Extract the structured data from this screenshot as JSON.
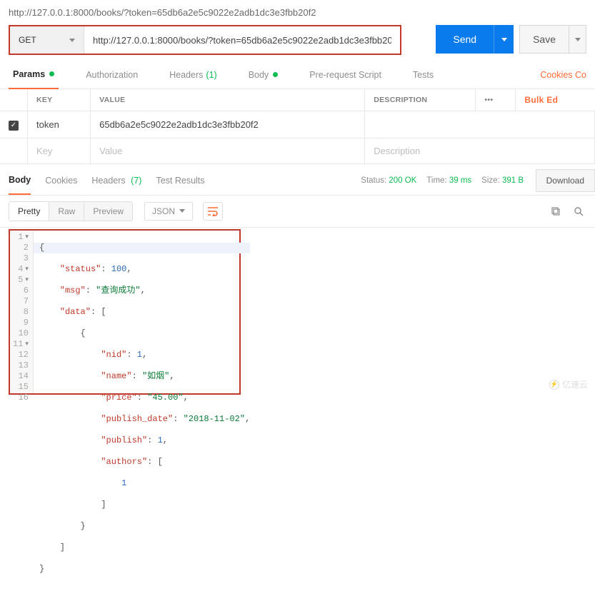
{
  "url_display": "http://127.0.0.1:8000/books/?token=65db6a2e5c9022e2adb1dc3e3fbb20f2",
  "request": {
    "method": "GET",
    "url": "http://127.0.0.1:8000/books/?token=65db6a2e5c9022e2adb1dc3e3fbb20f2"
  },
  "buttons": {
    "send": "Send",
    "save": "Save",
    "download": "Download"
  },
  "tabs": {
    "params": "Params",
    "authorization": "Authorization",
    "headers": "Headers",
    "headers_count": "(1)",
    "body": "Body",
    "prerequest": "Pre-request Script",
    "tests": "Tests",
    "cookies_link": "Cookies  Co"
  },
  "params_table": {
    "head": {
      "key": "KEY",
      "value": "VALUE",
      "desc": "DESCRIPTION",
      "more": "•••",
      "bulk": "Bulk Ed"
    },
    "row": {
      "key": "token",
      "value": "65db6a2e5c9022e2adb1dc3e3fbb20f2",
      "desc": ""
    },
    "placeholder": {
      "key": "Key",
      "value": "Value",
      "desc": "Description"
    }
  },
  "response_tabs": {
    "body": "Body",
    "cookies": "Cookies",
    "headers": "Headers",
    "headers_count": "(7)",
    "test_results": "Test Results"
  },
  "meta": {
    "status_label": "Status:",
    "status": "200 OK",
    "time_label": "Time:",
    "time": "39 ms",
    "size_label": "Size:",
    "size": "391 B"
  },
  "view": {
    "pretty": "Pretty",
    "raw": "Raw",
    "preview": "Preview",
    "lang": "JSON"
  },
  "json_body": {
    "status": 100,
    "msg": "查询成功",
    "data": [
      {
        "nid": 1,
        "name": "如烟",
        "price": "45.00",
        "publish_date": "2018-11-02",
        "publish": 1,
        "authors": [
          1
        ]
      }
    ]
  },
  "code_lines": {
    "l1": "{",
    "l2_k": "\"status\"",
    "l2_v": "100",
    "l3_k": "\"msg\"",
    "l3_v": "\"查询成功\"",
    "l4_k": "\"data\"",
    "l6_k": "\"nid\"",
    "l6_v": "1",
    "l7_k": "\"name\"",
    "l7_v": "\"如烟\"",
    "l8_k": "\"price\"",
    "l8_v": "\"45.00\"",
    "l9_k": "\"publish_date\"",
    "l9_v": "\"2018-11-02\"",
    "l10_k": "\"publish\"",
    "l10_v": "1",
    "l11_k": "\"authors\"",
    "l12_v": "1"
  },
  "watermark": "亿速云"
}
